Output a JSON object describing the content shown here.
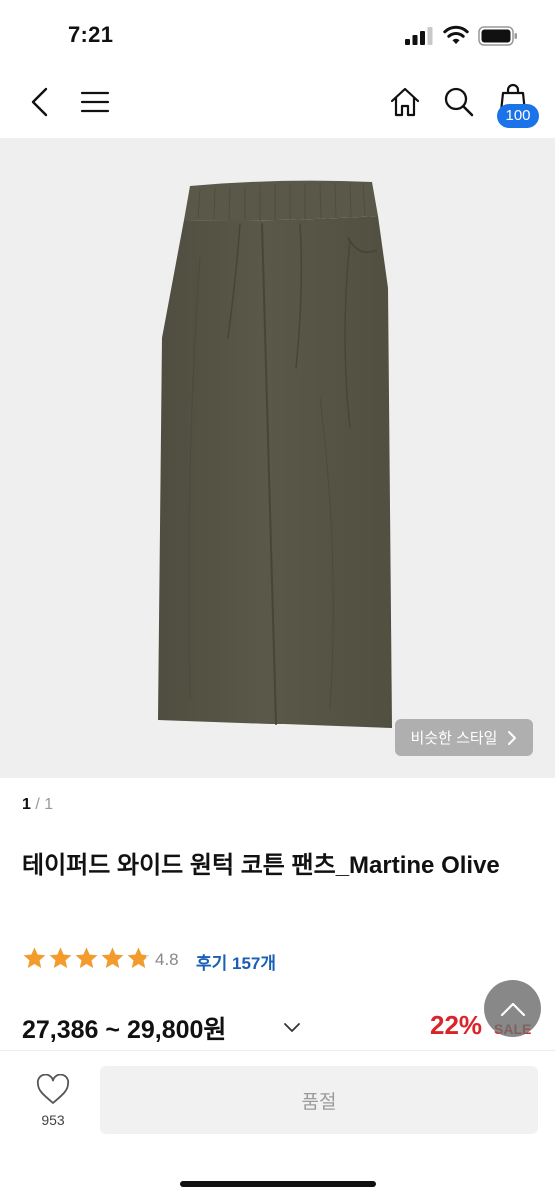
{
  "status_bar": {
    "time": "7:21"
  },
  "nav": {
    "cart_count": "100"
  },
  "gallery": {
    "similar_style_label": "비슷한 스타일",
    "current_page": "1",
    "separator": "/",
    "total_pages": "1"
  },
  "product": {
    "title": "테이퍼드 와이드 원턱 코튼 팬츠_Martine Olive",
    "rating": "4.8",
    "rating_value": 4.8,
    "review_label": "후기 157개",
    "price_range": "27,386 ~ 29,800원",
    "discount": "22%",
    "sale_label": "SALE",
    "garment_color": "#5a5848"
  },
  "bottom_bar": {
    "like_count": "953",
    "buy_button_label": "품절"
  },
  "colors": {
    "accent_blue": "#1a73e8",
    "star": "#f39c2c",
    "sale_red": "#d9252a"
  }
}
